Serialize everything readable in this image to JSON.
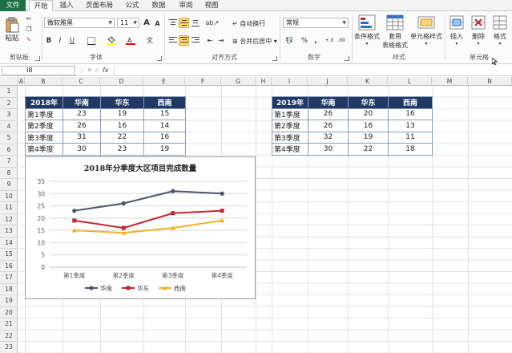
{
  "tabs": [
    "文件",
    "开始",
    "插入",
    "页面布局",
    "公式",
    "数据",
    "审阅",
    "视图"
  ],
  "ribbon": {
    "clipboard": {
      "paste": "粘贴",
      "label": "剪贴板"
    },
    "font": {
      "name": "微软雅黑",
      "size": "11",
      "bold": "B",
      "italic": "I",
      "underline": "U",
      "grow": "A",
      "shrink": "A",
      "label": "字体"
    },
    "align": {
      "wrap": "自动换行",
      "merge": "合并后居中",
      "label": "对齐方式"
    },
    "number": {
      "format": "常规",
      "percent": "%",
      "comma": ",",
      "label": "数字"
    },
    "styles": {
      "cond": "条件格式",
      "table1": "套用",
      "table2": "表格格式",
      "cell": "单元格样式",
      "label": "样式"
    },
    "cells": {
      "insert": "插入",
      "delete": "删除",
      "format": "格式",
      "label": "单元格"
    }
  },
  "namebox": "I8",
  "fx": "fx",
  "columns": [
    "A",
    "B",
    "C",
    "D",
    "E",
    "F",
    "G",
    "H",
    "I",
    "J",
    "K",
    "L",
    "M",
    "N"
  ],
  "rows": [
    "1",
    "2",
    "3",
    "4",
    "5",
    "6",
    "7",
    "8",
    "9",
    "10",
    "11",
    "12",
    "13",
    "14",
    "15",
    "16",
    "17",
    "18",
    "19",
    "20",
    "21",
    "22",
    "23"
  ],
  "table2018": {
    "headers": [
      "2018年",
      "华南",
      "华东",
      "西南"
    ],
    "rows": [
      [
        "第1季度",
        "23",
        "19",
        "15"
      ],
      [
        "第2季度",
        "26",
        "16",
        "14"
      ],
      [
        "第3季度",
        "31",
        "22",
        "16"
      ],
      [
        "第4季度",
        "30",
        "23",
        "19"
      ]
    ]
  },
  "table2019": {
    "headers": [
      "2019年",
      "华南",
      "华东",
      "西南"
    ],
    "rows": [
      [
        "第1季度",
        "26",
        "20",
        "16"
      ],
      [
        "第2季度",
        "26",
        "16",
        "13"
      ],
      [
        "第3季度",
        "32",
        "19",
        "11"
      ],
      [
        "第4季度",
        "30",
        "22",
        "18"
      ]
    ]
  },
  "chart_data": {
    "type": "line",
    "title": "2018年分季度大区项目完成数量",
    "categories": [
      "第1季度",
      "第2季度",
      "第3季度",
      "第4季度"
    ],
    "series": [
      {
        "name": "华南",
        "values": [
          23,
          26,
          31,
          30
        ],
        "color": "#4a5568",
        "marker": "circle"
      },
      {
        "name": "华东",
        "values": [
          19,
          16,
          22,
          23
        ],
        "color": "#c0282d",
        "marker": "square"
      },
      {
        "name": "西南",
        "values": [
          15,
          14,
          16,
          19
        ],
        "color": "#f0b323",
        "marker": "triangle"
      }
    ],
    "ylim": [
      0,
      35
    ],
    "yticks": [
      0,
      5,
      10,
      15,
      20,
      25,
      30,
      35
    ],
    "grid": true,
    "legend": "bottom"
  },
  "colors": {
    "excel_green": "#1e7145",
    "header_navy": "#1f3864"
  }
}
